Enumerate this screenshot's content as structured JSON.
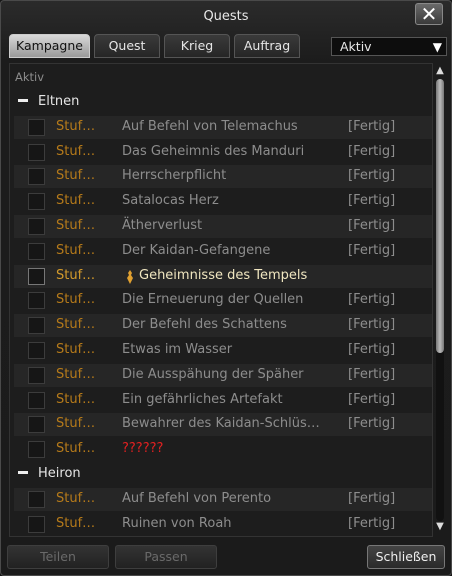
{
  "window": {
    "title": "Quests",
    "close_label": "✕"
  },
  "tabs": [
    {
      "label": "Kampagne",
      "active": true
    },
    {
      "label": "Quest"
    },
    {
      "label": "Krieg"
    },
    {
      "label": "Auftrag"
    }
  ],
  "filter": {
    "selected": "Aktiv",
    "arrow": "▼"
  },
  "list": {
    "section_label": "Aktiv",
    "groups": [
      {
        "name": "Eltnen",
        "quests": [
          {
            "level": "Stuf…",
            "name": "Auf Befehl von Telemachus",
            "status": "[Fertig]"
          },
          {
            "level": "Stuf…",
            "name": "Das Geheimnis des Manduri",
            "status": "[Fertig]"
          },
          {
            "level": "Stuf…",
            "name": "Herrscherpflicht",
            "status": "[Fertig]"
          },
          {
            "level": "Stuf…",
            "name": "Satalocas Herz",
            "status": "[Fertig]"
          },
          {
            "level": "Stuf…",
            "name": "Ätherverlust",
            "status": "[Fertig]"
          },
          {
            "level": "Stuf…",
            "name": "Der Kaidan-Gefangene",
            "status": "[Fertig]"
          },
          {
            "level": "Stuf…",
            "name": "Geheimnisse des Tempels",
            "status": "",
            "highlight": true
          },
          {
            "level": "Stuf…",
            "name": "Die Erneuerung der Quellen",
            "status": "[Fertig]"
          },
          {
            "level": "Stuf…",
            "name": "Der Befehl des Schattens",
            "status": "[Fertig]"
          },
          {
            "level": "Stuf…",
            "name": "Etwas im Wasser",
            "status": "[Fertig]"
          },
          {
            "level": "Stuf…",
            "name": "Die Ausspähung der Späher",
            "status": "[Fertig]"
          },
          {
            "level": "Stuf…",
            "name": "Ein gefährliches Artefakt",
            "status": "[Fertig]"
          },
          {
            "level": "Stuf…",
            "name": "Bewahrer des Kaidan-Schlüs…",
            "status": "[Fertig]"
          },
          {
            "level": "Stuf…",
            "name": "??????",
            "status": "",
            "unknown": true
          }
        ]
      },
      {
        "name": "Heiron",
        "quests": [
          {
            "level": "Stuf…",
            "name": "Auf Befehl von Perento",
            "status": "[Fertig]"
          },
          {
            "level": "Stuf…",
            "name": "Ruinen von Roah",
            "status": "[Fertig]"
          }
        ]
      }
    ]
  },
  "scrollbar": {
    "up": "▲",
    "down": "▼",
    "position": 0.0,
    "visible_fraction": 0.62
  },
  "footer": {
    "share_label": "Teilen",
    "pass_label": "Passen",
    "close_label": "Schließen"
  },
  "colors": {
    "level_text": "#b57a1a",
    "completed_text": "#8d8d8d",
    "active_quest_text": "#f0e6c0",
    "unknown_text": "#e02020"
  }
}
